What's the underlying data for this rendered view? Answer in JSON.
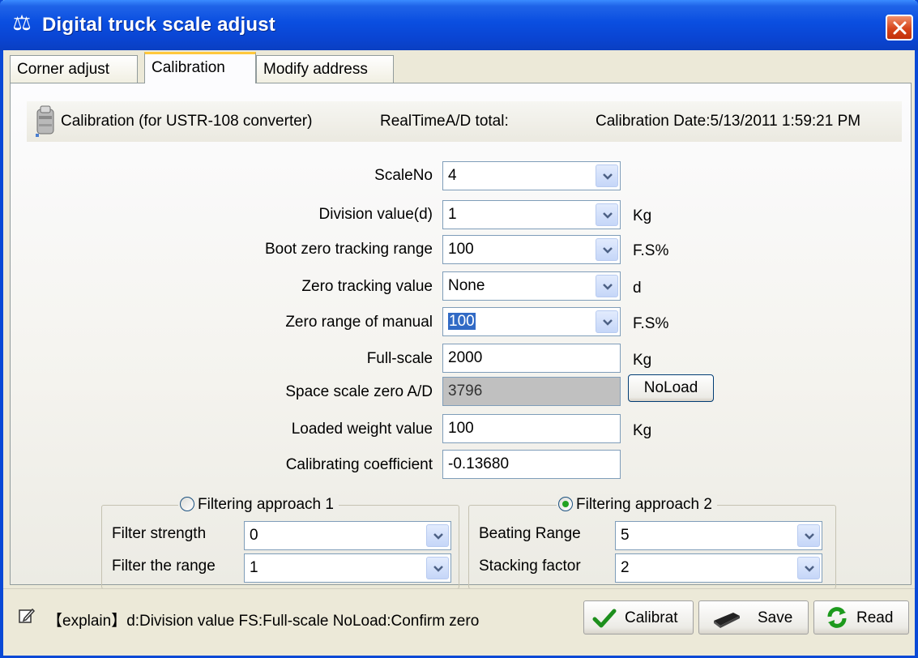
{
  "window": {
    "title": "Digital truck scale adjust"
  },
  "tabs": [
    {
      "label": "Corner adjust"
    },
    {
      "label": "Calibration"
    },
    {
      "label": "Modify address"
    }
  ],
  "header": {
    "calibration_label": "Calibration (for USTR-108  converter)",
    "realtime_label": "RealTimeA/D total:",
    "calibration_date": "Calibration Date:5/13/2011 1:59:21 PM"
  },
  "form": {
    "scale_no": {
      "label": "ScaleNo",
      "value": "4"
    },
    "division_value": {
      "label": "Division value(d)",
      "value": "1",
      "unit": "Kg"
    },
    "boot_zero": {
      "label": "Boot zero tracking range",
      "value": "100",
      "unit": "F.S%"
    },
    "zero_tracking": {
      "label": "Zero tracking value",
      "value": "None",
      "unit": "d"
    },
    "zero_manual": {
      "label": "Zero range of manual",
      "value": "100",
      "unit": "F.S%"
    },
    "full_scale": {
      "label": "Full-scale",
      "value": "2000",
      "unit": "Kg"
    },
    "space_zero": {
      "label": "Space scale zero A/D",
      "value": "3796"
    },
    "noload_button": "NoLoad",
    "loaded_weight": {
      "label": "Loaded weight value",
      "value": "100",
      "unit": "Kg"
    },
    "calibrating_coef": {
      "label": "Calibrating coefficient",
      "value": "-0.13680"
    }
  },
  "filter1": {
    "legend": "Filtering approach 1",
    "selected": false,
    "strength_label": "Filter strength",
    "strength_value": "0",
    "range_label": "Filter the range",
    "range_value": "1"
  },
  "filter2": {
    "legend": "Filtering approach 2",
    "selected": true,
    "beating_label": "Beating Range",
    "beating_value": "5",
    "stacking_label": "Stacking factor",
    "stacking_value": "2"
  },
  "status": {
    "explain": "【explain】d:Division value  FS:Full-scale  NoLoad:Confirm zero"
  },
  "buttons": {
    "calibrate": "Calibrat",
    "save": "Save",
    "read": "Read"
  },
  "colors": {
    "title_bar": "#0a4ee0",
    "selection": "#316ac5",
    "active_tab_accent": "#ffc83c"
  }
}
